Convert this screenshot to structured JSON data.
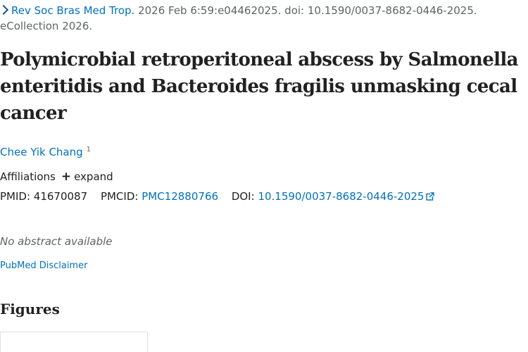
{
  "citation": {
    "journal": "Rev Soc Bras Med Trop.",
    "details_line1": " 2026 Feb 6:59:e04462025. doi: 10.1590/0037-8682-0446-2025.",
    "details_line2": "eCollection 2026."
  },
  "article": {
    "title": "Polymicrobial retroperitoneal abscess by Salmonella enteritidis and Bacteroides fragilis unmasking cecal cancer"
  },
  "authors": [
    {
      "name": "Chee Yik Chang",
      "affiliation_ref": "1"
    }
  ],
  "affiliations": {
    "label": "Affiliations",
    "expand_symbol": "+",
    "expand_label": "expand"
  },
  "identifiers": {
    "pmid_label": "PMID:",
    "pmid": "41670087",
    "pmcid_label": "PMCID:",
    "pmcid": "PMC12880766",
    "doi_label": "DOI:",
    "doi": "10.1590/0037-8682-0446-2025"
  },
  "abstract": {
    "status": "No abstract available"
  },
  "disclaimer": {
    "label": "PubMed Disclaimer"
  },
  "figures": {
    "heading": "Figures"
  },
  "colors": {
    "link": "#0071bc",
    "chevron": "#205493",
    "muted_text": "#5f6368",
    "body_text": "#212121"
  },
  "icons": {
    "breadcrumb": "chevron-right-icon",
    "external": "external-link-icon"
  }
}
